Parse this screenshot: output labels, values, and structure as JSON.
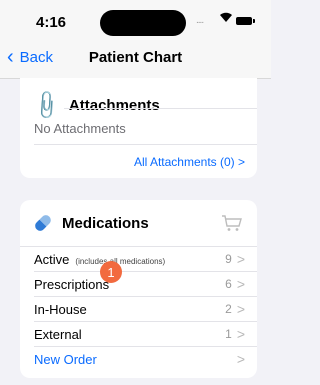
{
  "status_bar": {
    "time": "4:16",
    "signal": "....",
    "wifi": "▼"
  },
  "nav": {
    "back_label": "Back",
    "title": "Patient Chart"
  },
  "attachments": {
    "title": "Attachments",
    "empty_text": "No Attachments",
    "all_link": "All Attachments (0)  >"
  },
  "medications": {
    "title": "Medications",
    "rows": [
      {
        "label": "Active",
        "note": "(includes all medications)",
        "count": "9"
      },
      {
        "label": "Prescriptions",
        "note": "",
        "count": "6"
      },
      {
        "label": "In-House",
        "note": "",
        "count": "2"
      },
      {
        "label": "External",
        "note": "",
        "count": "1"
      }
    ],
    "new_order_label": "New Order",
    "badge": "1",
    "chevron": ">"
  },
  "colors": {
    "accent": "#0a6bff",
    "badge": "#f26a3f"
  }
}
